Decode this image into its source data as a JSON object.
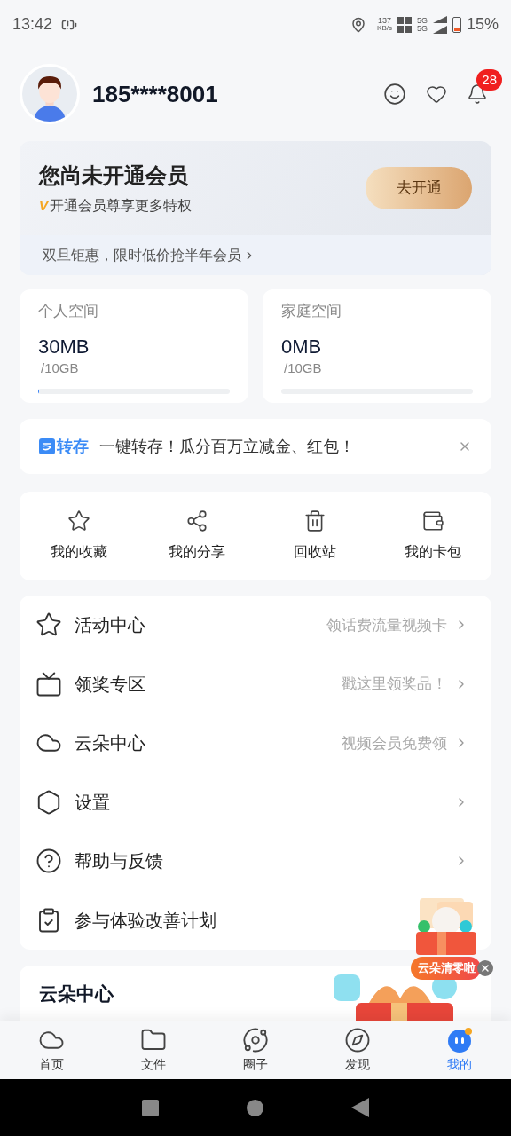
{
  "status_bar": {
    "time": "13:42",
    "speed": "137",
    "speed_unit": "KB/s",
    "net_top": "5G",
    "net_bottom": "5G",
    "battery": "15%"
  },
  "profile": {
    "phone": "185****8001",
    "notifications": "28"
  },
  "membership": {
    "title": "您尚未开通会员",
    "badge": "V",
    "subtitle": "开通会员尊享更多特权",
    "button": "去开通",
    "promo": "双旦钜惠，限时低价抢半年会员"
  },
  "storage": [
    {
      "label": "个人空间",
      "used": "30MB",
      "total": "/10GB",
      "level": 0.003
    },
    {
      "label": "家庭空间",
      "used": "0MB",
      "total": "/10GB",
      "level": 0
    }
  ],
  "banner": {
    "tag": "转存",
    "text": "一键转存！瓜分百万立减金、红包！"
  },
  "shortcuts": [
    {
      "kind": "star",
      "label": "我的收藏"
    },
    {
      "kind": "share",
      "label": "我的分享"
    },
    {
      "kind": "trash",
      "label": "回收站"
    },
    {
      "kind": "wallet",
      "label": "我的卡包"
    }
  ],
  "menu": [
    {
      "kind": "star",
      "label": "活动中心",
      "hint": "领话费流量视频卡",
      "arrow": true
    },
    {
      "kind": "tv",
      "label": "领奖专区",
      "hint": "戳这里领奖品！",
      "arrow": true
    },
    {
      "kind": "cloud",
      "label": "云朵中心",
      "hint": "视频会员免费领",
      "arrow": true
    },
    {
      "kind": "settings",
      "label": "设置",
      "arrow": true
    },
    {
      "kind": "help",
      "label": "帮助与反馈",
      "arrow": true
    },
    {
      "kind": "survey",
      "label": "参与体验改善计划"
    }
  ],
  "cloud_card": {
    "title": "云朵中心"
  },
  "floating_promo": {
    "label": "云朵清零啦"
  },
  "bottom_nav": [
    {
      "kind": "home",
      "label": "首页",
      "selected": false
    },
    {
      "kind": "files",
      "label": "文件",
      "selected": false
    },
    {
      "kind": "circle",
      "label": "圈子",
      "selected": false
    },
    {
      "kind": "discover",
      "label": "发现",
      "selected": false
    },
    {
      "kind": "me",
      "label": "我的",
      "selected": true
    }
  ]
}
